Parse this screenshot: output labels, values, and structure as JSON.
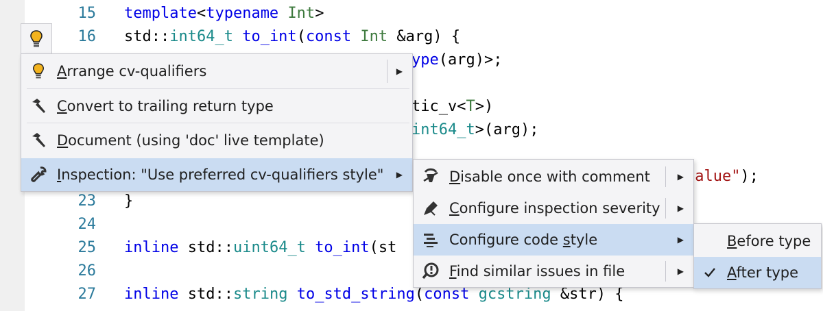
{
  "editor": {
    "lines": [
      {
        "num": "15",
        "segments": [
          {
            "t": "template",
            "c": "kw"
          },
          {
            "t": "<",
            "c": "pl"
          },
          {
            "t": "typename",
            "c": "kw"
          },
          {
            "t": " ",
            "c": "pl"
          },
          {
            "t": "Int",
            "c": "tp"
          },
          {
            "t": ">",
            "c": "pl"
          }
        ]
      },
      {
        "num": "16",
        "segments": [
          {
            "t": "std::",
            "c": "pl"
          },
          {
            "t": "int64_t",
            "c": "ty"
          },
          {
            "t": " ",
            "c": "pl"
          },
          {
            "t": "to_int",
            "c": "kw"
          },
          {
            "t": "(",
            "c": "pl"
          },
          {
            "t": "const",
            "c": "kw"
          },
          {
            "t": " ",
            "c": "pl"
          },
          {
            "t": "Int",
            "c": "tp"
          },
          {
            "t": " &arg) {",
            "c": "pl"
          }
        ]
      },
      {
        "num": "",
        "segments": [
          {
            "t": "ype",
            "c": "kw"
          },
          {
            "t": "(arg)>;",
            "c": "pl"
          }
        ]
      },
      {
        "num": "",
        "segments": [
          {
            "t": "tic_v<",
            "c": "pl"
          },
          {
            "t": "T",
            "c": "tp"
          },
          {
            "t": ">)",
            "c": "pl"
          }
        ]
      },
      {
        "num": "",
        "segments": [
          {
            "t": "int64_t",
            "c": "ty"
          },
          {
            "t": ">(arg);",
            "c": "pl"
          }
        ]
      },
      {
        "num": "",
        "segments": [
          {
            "t": "value\"",
            "c": "st"
          },
          {
            "t": ");",
            "c": "pl"
          }
        ]
      },
      {
        "num": "23",
        "segments": [
          {
            "t": "}",
            "c": "pl"
          }
        ]
      },
      {
        "num": "24",
        "segments": []
      },
      {
        "num": "25",
        "segments": [
          {
            "t": "inline",
            "c": "kw"
          },
          {
            "t": " std::",
            "c": "pl"
          },
          {
            "t": "uint64_t",
            "c": "ty"
          },
          {
            "t": " ",
            "c": "pl"
          },
          {
            "t": "to_int",
            "c": "kw"
          },
          {
            "t": "(st",
            "c": "pl"
          }
        ]
      },
      {
        "num": "26",
        "segments": []
      },
      {
        "num": "27",
        "segments": [
          {
            "t": "inline",
            "c": "kw"
          },
          {
            "t": " std::",
            "c": "pl"
          },
          {
            "t": "string",
            "c": "ty"
          },
          {
            "t": " ",
            "c": "pl"
          },
          {
            "t": "to_std_string",
            "c": "kw"
          },
          {
            "t": "(",
            "c": "pl"
          },
          {
            "t": "const",
            "c": "kw"
          },
          {
            "t": " ",
            "c": "pl"
          },
          {
            "t": "gcstring",
            "c": "ty"
          },
          {
            "t": " &str) {",
            "c": "pl"
          }
        ]
      }
    ]
  },
  "colors": {
    "keyword": "#0000e6",
    "type": "#1a8a8a",
    "template_param": "#3e7a3e",
    "string": "#a31515",
    "line_number": "#2b7a9b",
    "menu_bg": "#f4f4f6",
    "selected_bg": "#cadcf2"
  },
  "menu": {
    "items": [
      {
        "icon": "lightbulb-icon",
        "mnemonic": "A",
        "rest": "rrange cv-qualifiers",
        "has_submenu": true
      },
      {
        "icon": "hammer-icon",
        "mnemonic": "C",
        "rest": "onvert to trailing return type",
        "has_submenu": false
      },
      {
        "icon": "hammer-icon",
        "mnemonic": "D",
        "rest": "ocument (using 'doc' live template)",
        "has_submenu": false
      },
      {
        "icon": "wrench-icon",
        "mnemonic": "I",
        "rest": "nspection: \"Use preferred cv-qualifiers style\"",
        "has_submenu": true
      }
    ]
  },
  "submenu": {
    "items": [
      {
        "icon": "disable-comment-icon",
        "mnemonic": "D",
        "rest": "isable once with comment"
      },
      {
        "icon": "severity-pen-icon",
        "mnemonic": "C",
        "rest": "onfigure inspection severity"
      },
      {
        "icon": "code-style-icon",
        "pre": "Configure code ",
        "mnemonic": "s",
        "rest": "tyle"
      },
      {
        "icon": "find-issues-icon",
        "mnemonic": "F",
        "rest": "ind similar issues in file"
      }
    ]
  },
  "style_menu": {
    "items": [
      {
        "mnemonic": "B",
        "rest": "efore type",
        "checked": false
      },
      {
        "mnemonic": "A",
        "rest": "fter type",
        "checked": true
      }
    ]
  }
}
